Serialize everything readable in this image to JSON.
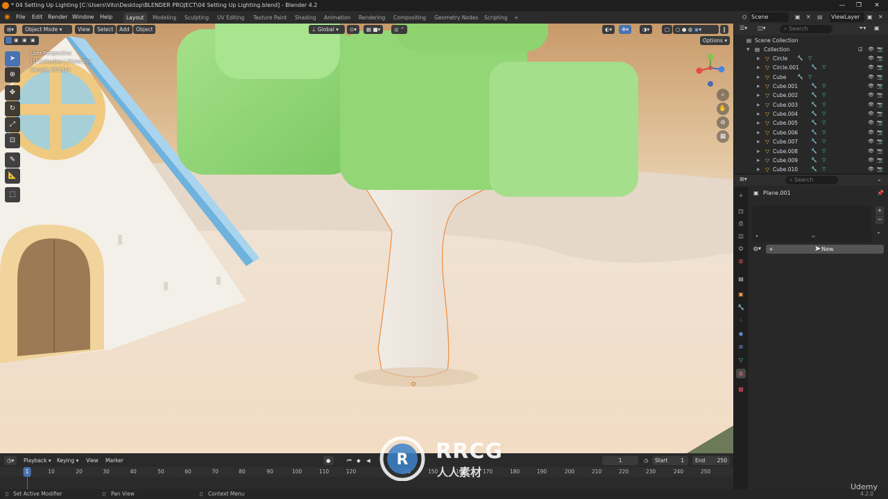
{
  "window": {
    "title": "* 04 Setting Up Lighting [C:\\Users\\Vito\\Desktop\\BLENDER PROJECT\\04 Setting Up Lighting.blend] - Blender 4.2"
  },
  "menu": [
    "File",
    "Edit",
    "Render",
    "Window",
    "Help"
  ],
  "workspaces": [
    "Layout",
    "Modeling",
    "Sculpting",
    "UV Editing",
    "Texture Paint",
    "Shading",
    "Animation",
    "Rendering",
    "Compositing",
    "Geometry Nodes",
    "Scripting",
    "+"
  ],
  "scene": {
    "label": "Scene",
    "viewlayer": "ViewLayer"
  },
  "viewport": {
    "mode": "Object Mode",
    "menus": [
      "View",
      "Select",
      "Add",
      "Object"
    ],
    "orientation": "Global",
    "options": "Options",
    "info": [
      "User Perspective",
      "(1) Collection | Plane.001",
      "Sample 38/1024"
    ]
  },
  "outliner": {
    "search_placeholder": "Search",
    "root": "Scene Collection",
    "collection": "Collection",
    "items": [
      "Circle",
      "Circle.001",
      "Cube",
      "Cube.001",
      "Cube.002",
      "Cube.003",
      "Cube.004",
      "Cube.005",
      "Cube.006",
      "Cube.007",
      "Cube.008",
      "Cube.009",
      "Cube.010"
    ]
  },
  "properties": {
    "search_placeholder": "Search",
    "object_name": "Plane.001",
    "new_button": "New"
  },
  "timeline": {
    "menus": [
      "Playback",
      "Keying",
      "View",
      "Marker"
    ],
    "current_frame": "1",
    "start_label": "Start",
    "start": "1",
    "end_label": "End",
    "end": "250",
    "ruler": [
      "1",
      "10",
      "20",
      "30",
      "40",
      "50",
      "60",
      "70",
      "80",
      "90",
      "100",
      "110",
      "120",
      "140",
      "150",
      "160",
      "170",
      "180",
      "190",
      "200",
      "210",
      "220",
      "230",
      "240",
      "250"
    ]
  },
  "status": {
    "left": "Set Active Modifier",
    "middle": "Pan View",
    "right": "Context Menu",
    "version": "4.2.0"
  },
  "watermark": {
    "brand": "RRCG",
    "sub": "人人素材",
    "corner": "Udemy"
  }
}
